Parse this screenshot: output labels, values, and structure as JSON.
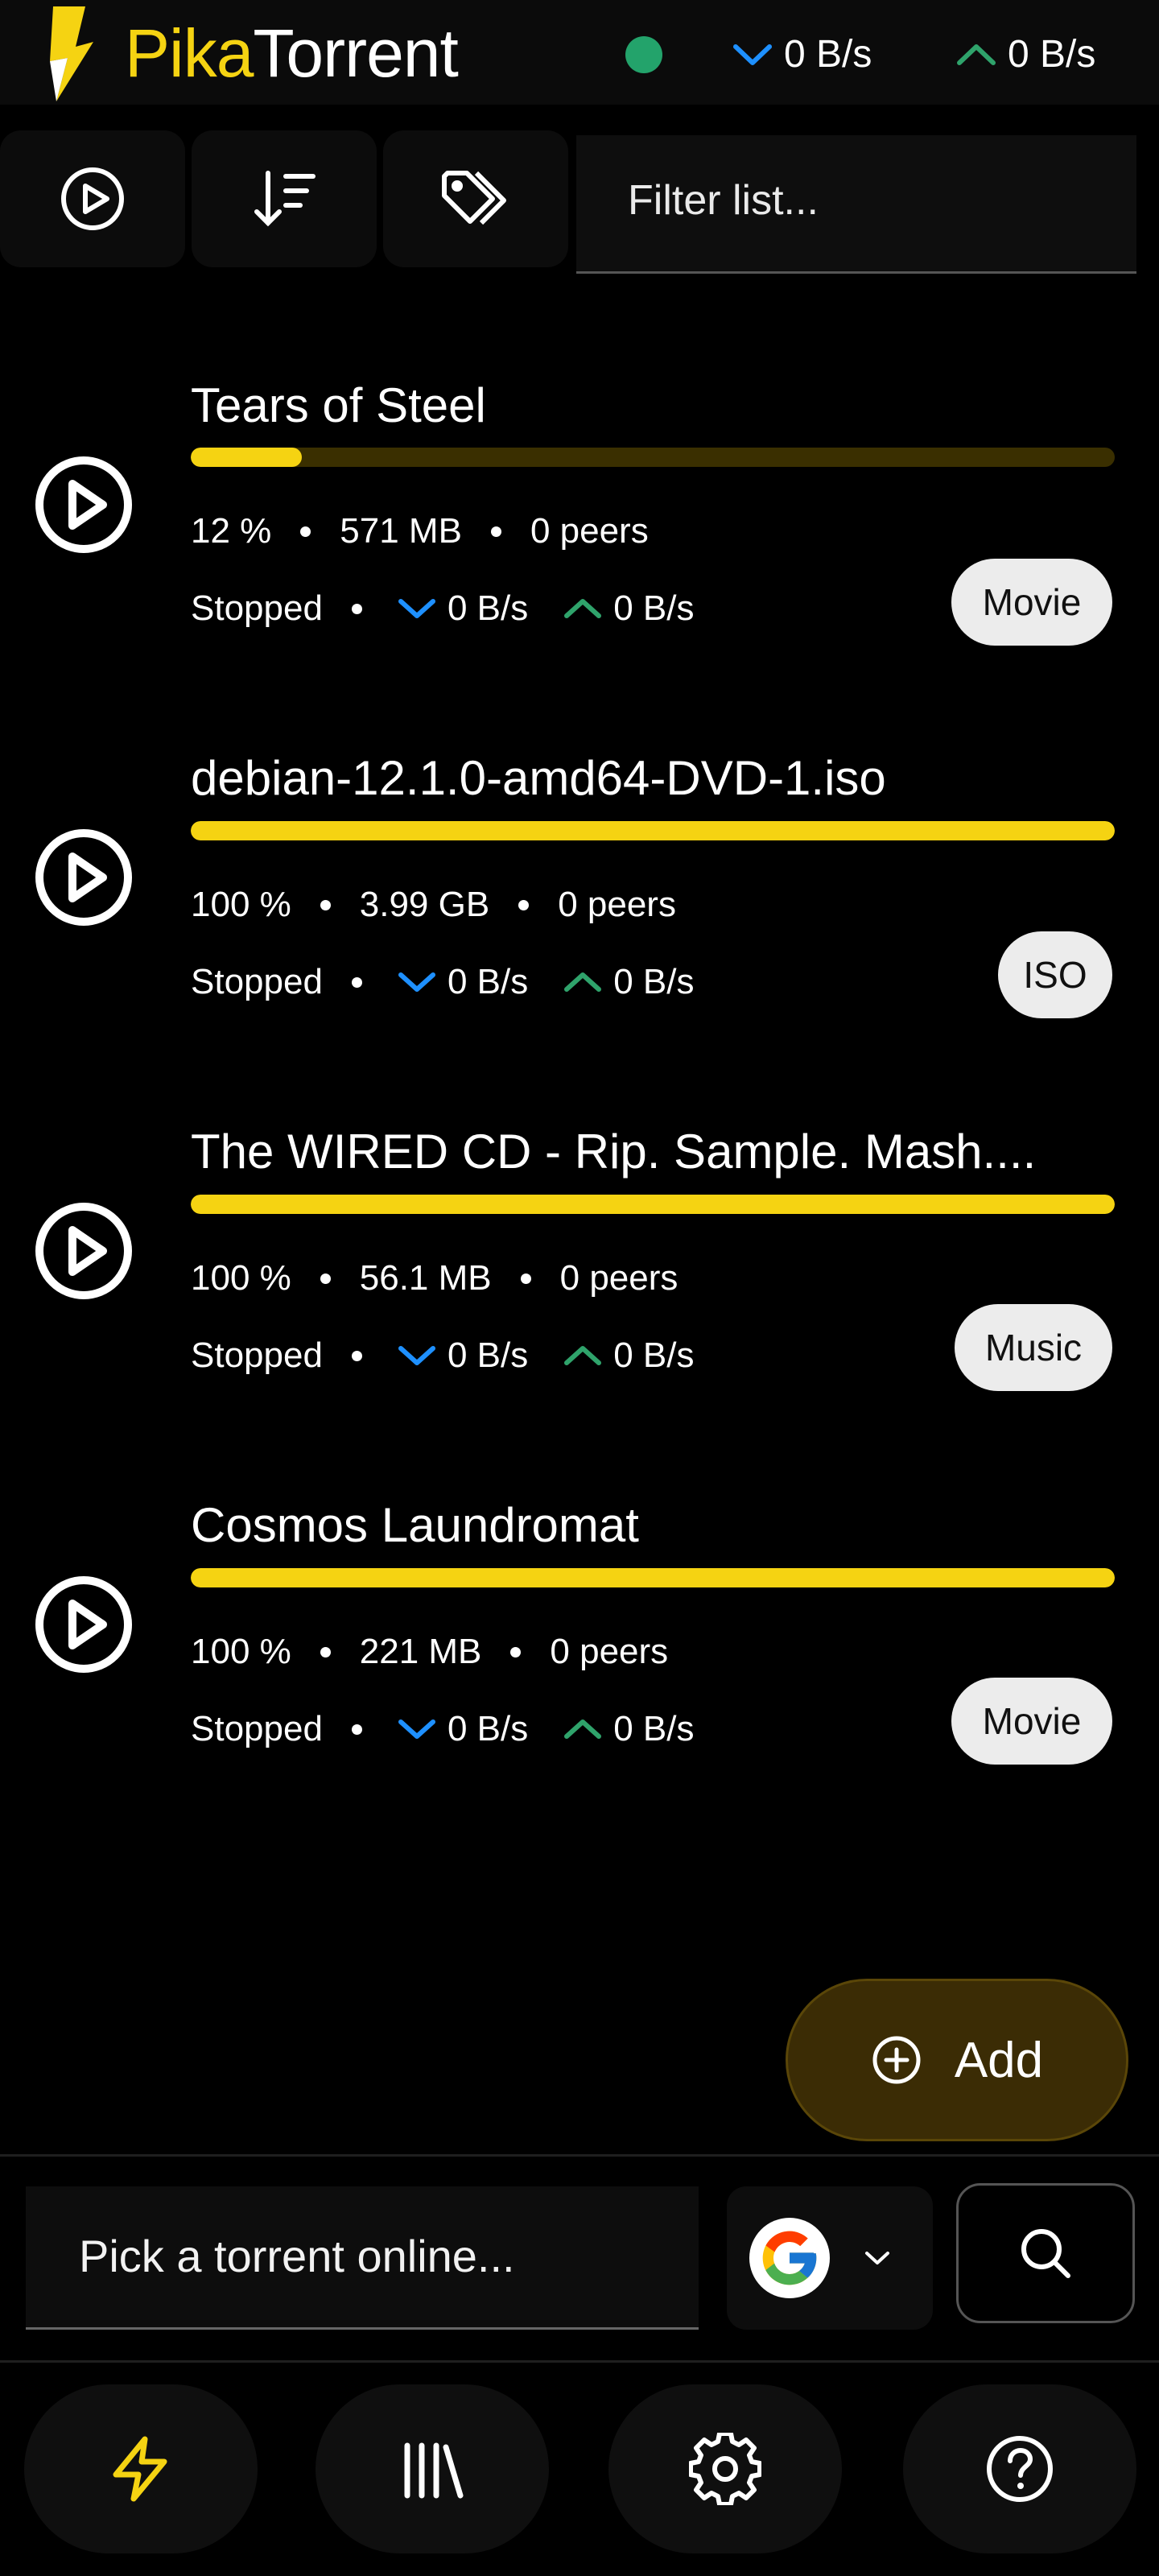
{
  "header": {
    "brand_prefix": "Pika",
    "brand_suffix": "Torrent",
    "download_speed": "0 B/s",
    "upload_speed": "0 B/s",
    "status_color": "#23a36b"
  },
  "toolbar": {
    "icons": [
      "play-icon",
      "sort-icon",
      "tags-icon"
    ],
    "filter_placeholder": "Filter list..."
  },
  "torrents": [
    {
      "name": "Tears of Steel",
      "progress": 0.12,
      "percent": "12 %",
      "size": "571 MB",
      "peers": "0 peers",
      "status": "Stopped",
      "down": "0 B/s",
      "up": "0 B/s",
      "tag": "Movie"
    },
    {
      "name": "debian-12.1.0-amd64-DVD-1.iso",
      "progress": 1.0,
      "percent": "100 %",
      "size": "3.99 GB",
      "peers": "0 peers",
      "status": "Stopped",
      "down": "0 B/s",
      "up": "0 B/s",
      "tag": "ISO"
    },
    {
      "name": "The WIRED CD - Rip. Sample. Mash....",
      "progress": 1.0,
      "percent": "100 %",
      "size": "56.1 MB",
      "peers": "0 peers",
      "status": "Stopped",
      "down": "0 B/s",
      "up": "0 B/s",
      "tag": "Music"
    },
    {
      "name": "Cosmos Laundromat",
      "progress": 1.0,
      "percent": "100 %",
      "size": "221 MB",
      "peers": "0 peers",
      "status": "Stopped",
      "down": "0 B/s",
      "up": "0 B/s",
      "tag": "Movie"
    }
  ],
  "add_button": {
    "label": "Add"
  },
  "search": {
    "placeholder": "Pick a torrent online...",
    "engine_icon": "google-g-icon"
  },
  "bottom_nav": {
    "icons": [
      "bolt-icon",
      "library-icon",
      "settings-icon",
      "help-icon"
    ]
  },
  "colors": {
    "accent": "#f5d312",
    "down": "#1e90ff",
    "up": "#2fa36b",
    "background": "#000000"
  }
}
